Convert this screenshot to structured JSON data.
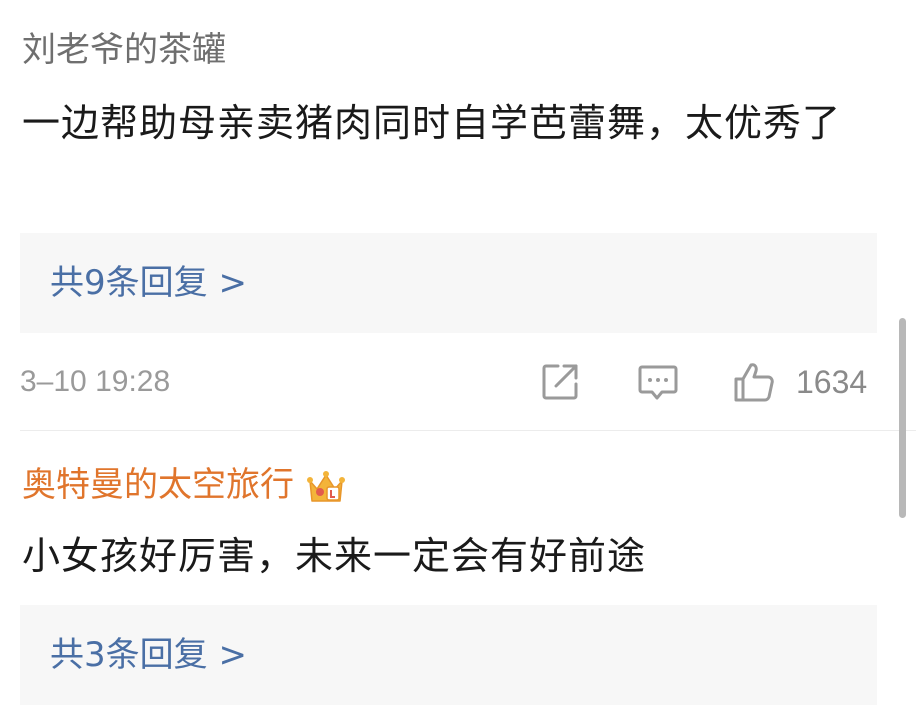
{
  "comments": [
    {
      "username": "刘老爷的茶罐",
      "content": "一边帮助母亲卖猪肉同时自学芭蕾舞，太优秀了",
      "reply_label": "共9条回复 >",
      "timestamp": "3–10 19:28",
      "like_count": "1634"
    },
    {
      "username": "奥特曼的太空旅行",
      "content": "小女孩好厉害，未来一定会有好前途",
      "reply_label": "共3条回复 >"
    }
  ],
  "icons": {
    "share": "share-icon",
    "comment": "comment-icon",
    "like": "thumbs-up-icon",
    "badge": "crown-icon"
  },
  "colors": {
    "username": "#6f6f6f",
    "vip_username": "#e0752c",
    "reply_link": "#4a6fa5",
    "reply_bg": "#f7f7f7",
    "meta_text": "#9a9a9a"
  }
}
